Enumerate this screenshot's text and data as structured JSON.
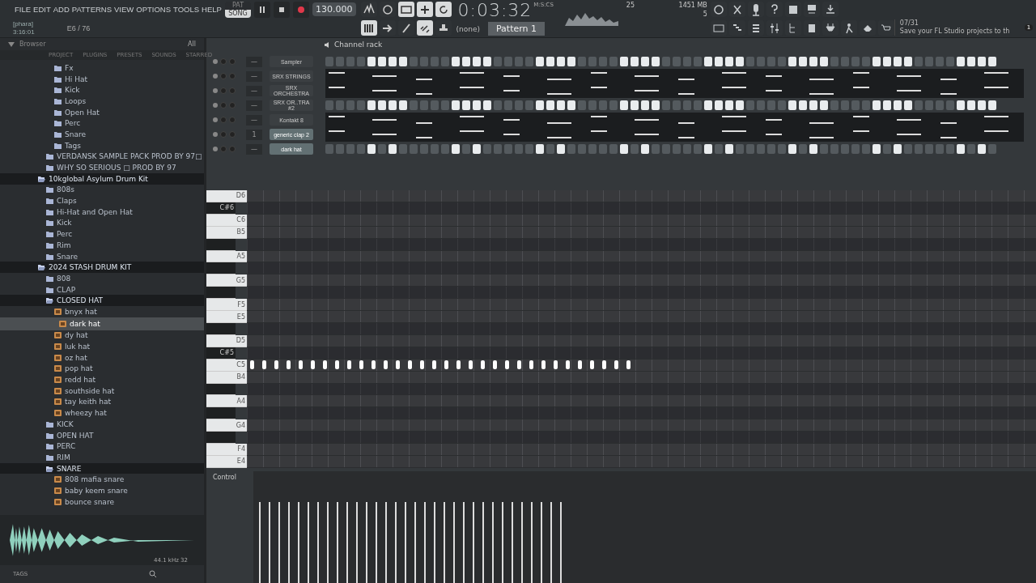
{
  "menu": [
    "FILE",
    "EDIT",
    "ADD",
    "PATTERNS",
    "VIEW",
    "OPTIONS",
    "TOOLS",
    "HELP"
  ],
  "hint": {
    "line_1": "[phara]",
    "line_2": "3:16:01",
    "coords": "E6 / 76"
  },
  "transport": {
    "modes": [
      {
        "label": "PAT",
        "selected": false
      },
      {
        "label": "SONG",
        "selected": true
      }
    ],
    "playing": false,
    "recording": true,
    "tempo": "130.000"
  },
  "toolbar_top": [
    {
      "kind": "wave",
      "on": false
    },
    {
      "kind": "loop",
      "on": false
    },
    {
      "kind": "counter",
      "on": true
    },
    {
      "kind": "plus",
      "on": true
    },
    {
      "kind": "cycle",
      "on": true
    }
  ],
  "toolbar_bottom": [
    {
      "kind": "keys",
      "on": true
    },
    {
      "kind": "arrow",
      "on": false
    },
    {
      "kind": "pen",
      "on": false
    },
    {
      "kind": "link",
      "on": true
    },
    {
      "kind": "stamp",
      "on": false
    }
  ],
  "time": {
    "value": "0:03:32",
    "unit": "M:S:CS"
  },
  "monitor": {
    "cpu": "25",
    "memory": "1451 MB",
    "polyphony": "5"
  },
  "pattern": {
    "selector": "(none)",
    "name": "Pattern 1"
  },
  "news": {
    "counter": "07/31",
    "text": "Save your FL Studio projects to th",
    "badge": "1"
  },
  "browser": {
    "title": "Browser",
    "tabs": [
      "PROJECT",
      "PLUGINS",
      "PRESETS",
      "SOUNDS",
      "STARRED"
    ],
    "filter": "All",
    "tree": [
      {
        "children": [
          {
            "children": [
              {
                "kind": "folder",
                "label": "Fx",
                "expanded": false
              },
              {
                "kind": "folder",
                "label": "Hi Hat",
                "expanded": false
              },
              {
                "kind": "folder",
                "label": "Kick",
                "expanded": false
              },
              {
                "kind": "folder",
                "label": "Loops",
                "expanded": false
              },
              {
                "kind": "folder",
                "label": "Open Hat",
                "expanded": false
              },
              {
                "kind": "folder",
                "label": "Perc",
                "expanded": false
              },
              {
                "kind": "folder",
                "label": "Snare",
                "expanded": false
              },
              {
                "kind": "folder",
                "label": "Tags",
                "expanded": false
              }
            ]
          },
          {
            "kind": "folder",
            "label": "VERDANSK SAMPLE PACK PROD BY 97□",
            "expanded": false
          },
          {
            "kind": "folder",
            "label": "WHY SO SERIOUS □ PROD BY 97",
            "expanded": false
          }
        ]
      },
      {
        "kind": "folder",
        "label": "10kglobal Asylum Drum Kit",
        "expanded": true,
        "children": [
          {
            "kind": "folder",
            "label": "808s",
            "expanded": false
          },
          {
            "kind": "folder",
            "label": "Claps",
            "expanded": false
          },
          {
            "kind": "folder",
            "label": "Hi-Hat and Open Hat",
            "expanded": false
          },
          {
            "kind": "folder",
            "label": "Kick",
            "expanded": false
          },
          {
            "kind": "folder",
            "label": "Perc",
            "expanded": false
          },
          {
            "kind": "folder",
            "label": "Rim",
            "expanded": false
          },
          {
            "kind": "folder",
            "label": "Snare",
            "expanded": false
          }
        ]
      },
      {
        "kind": "folder",
        "label": "2024 STASH DRUM KIT",
        "expanded": true,
        "children": [
          {
            "kind": "folder",
            "label": "808",
            "expanded": false
          },
          {
            "kind": "folder",
            "label": "CLAP",
            "expanded": false
          },
          {
            "kind": "folder",
            "label": "CLOSED HAT",
            "expanded": true,
            "children": [
              {
                "kind": "file",
                "label": "bnyx hat",
                "selected": false
              },
              {
                "kind": "file",
                "label": "dark hat",
                "selected": true
              },
              {
                "kind": "file",
                "label": "dy hat",
                "selected": false
              },
              {
                "kind": "file",
                "label": "luk hat",
                "selected": false
              },
              {
                "kind": "file",
                "label": "oz hat",
                "selected": false
              },
              {
                "kind": "file",
                "label": "pop hat",
                "selected": false
              },
              {
                "kind": "file",
                "label": "redd hat",
                "selected": false
              },
              {
                "kind": "file",
                "label": "southside hat",
                "selected": false
              },
              {
                "kind": "file",
                "label": "tay keith hat",
                "selected": false
              },
              {
                "kind": "file",
                "label": "wheezy hat",
                "selected": false
              }
            ]
          },
          {
            "kind": "folder",
            "label": "KICK",
            "expanded": false
          },
          {
            "kind": "folder",
            "label": "OPEN HAT",
            "expanded": false
          },
          {
            "kind": "folder",
            "label": "PERC",
            "expanded": false
          },
          {
            "kind": "folder",
            "label": "RIM",
            "expanded": false
          },
          {
            "kind": "folder",
            "label": "SNARE",
            "expanded": true,
            "children": [
              {
                "kind": "file",
                "label": "808 mafia snare",
                "selected": false
              },
              {
                "kind": "file",
                "label": "baby keem snare",
                "selected": false
              },
              {
                "kind": "file",
                "label": "bounce snare",
                "selected": false
              }
            ]
          }
        ]
      }
    ],
    "preview_format": "44.1 kHz 32",
    "tags_label": "TAGS"
  },
  "channel_rack": {
    "title": "Channel rack",
    "channels": [
      {
        "name": "Sampler",
        "number": "—",
        "selected": false,
        "kind": "steps",
        "steps": [
          false,
          false,
          false,
          false,
          true,
          true,
          true,
          true,
          false,
          false,
          false,
          false,
          true,
          true,
          true,
          true,
          false,
          false,
          false,
          false,
          true,
          true,
          true,
          true,
          false,
          false,
          false,
          false,
          true,
          true,
          true,
          true,
          false,
          false,
          false,
          false,
          true,
          true,
          true,
          true,
          false,
          false,
          false,
          false,
          true,
          true,
          true,
          true,
          false,
          false,
          false,
          false,
          true,
          true,
          true,
          true,
          false,
          false,
          false,
          false,
          true,
          true,
          true,
          true
        ]
      },
      {
        "name": "SRX STRINGS",
        "number": "—",
        "selected": false,
        "kind": "preview"
      },
      {
        "name": "SRX ORCHESTRA",
        "number": "—",
        "selected": false,
        "kind": "preview"
      },
      {
        "name": "SRX OR..TRA #2",
        "number": "—",
        "selected": false,
        "kind": "steps",
        "steps": [
          false,
          false,
          false,
          false,
          true,
          true,
          true,
          true,
          false,
          false,
          false,
          false,
          true,
          true,
          true,
          true,
          false,
          false,
          false,
          false,
          true,
          true,
          true,
          true,
          false,
          false,
          false,
          false,
          true,
          true,
          true,
          true,
          false,
          false,
          false,
          false,
          true,
          true,
          true,
          true,
          false,
          false,
          false,
          false,
          true,
          true,
          true,
          true,
          false,
          false,
          false,
          false,
          true,
          true,
          true,
          true,
          false,
          false,
          false,
          false,
          true,
          true,
          true,
          true
        ]
      },
      {
        "name": "Kontakt 8",
        "number": "—",
        "selected": false,
        "kind": "preview"
      },
      {
        "name": "generic clap 2",
        "number": "1",
        "selected": true,
        "kind": "preview"
      },
      {
        "name": "dark hat",
        "number": "—",
        "selected": true,
        "kind": "steps",
        "steps": [
          false,
          false,
          false,
          false,
          true,
          false,
          true,
          false,
          false,
          false,
          false,
          false,
          true,
          false,
          true,
          false,
          false,
          false,
          false,
          false,
          true,
          false,
          true,
          false,
          false,
          false,
          false,
          false,
          true,
          false,
          true,
          false,
          false,
          false,
          false,
          false,
          true,
          false,
          true,
          false,
          false,
          false,
          false,
          false,
          true,
          false,
          true,
          false,
          false,
          false,
          false,
          false,
          true,
          false,
          true,
          false,
          false,
          false,
          false,
          false,
          true,
          false,
          true,
          false
        ]
      }
    ]
  },
  "piano_roll": {
    "keys": [
      {
        "kind": "white",
        "label": "D6",
        "notes": false
      },
      {
        "kind": "black",
        "label": "C#6",
        "notes": false
      },
      {
        "kind": "white",
        "label": "C6",
        "notes": false
      },
      {
        "kind": "white",
        "label": "B5",
        "notes": false
      },
      {
        "kind": "black",
        "notes": false
      },
      {
        "kind": "white",
        "label": "A5",
        "notes": false
      },
      {
        "kind": "black",
        "notes": false
      },
      {
        "kind": "white",
        "label": "G5",
        "notes": false
      },
      {
        "kind": "black",
        "notes": false
      },
      {
        "kind": "white",
        "label": "F5",
        "notes": false
      },
      {
        "kind": "white",
        "label": "E5",
        "notes": false
      },
      {
        "kind": "black",
        "notes": false
      },
      {
        "kind": "white",
        "label": "D5",
        "notes": false
      },
      {
        "kind": "black",
        "label": "C#5",
        "notes": false
      },
      {
        "kind": "white",
        "label": "C5",
        "notes": true
      },
      {
        "kind": "white",
        "label": "B4",
        "notes": false
      },
      {
        "kind": "black",
        "notes": false
      },
      {
        "kind": "white",
        "label": "A4",
        "notes": false
      },
      {
        "kind": "black",
        "notes": false
      },
      {
        "kind": "white",
        "label": "G4",
        "notes": false
      },
      {
        "kind": "black",
        "notes": false
      },
      {
        "kind": "white",
        "label": "F4",
        "notes": false
      },
      {
        "kind": "white",
        "label": "E4",
        "notes": false
      }
    ],
    "control_label": "Control"
  }
}
